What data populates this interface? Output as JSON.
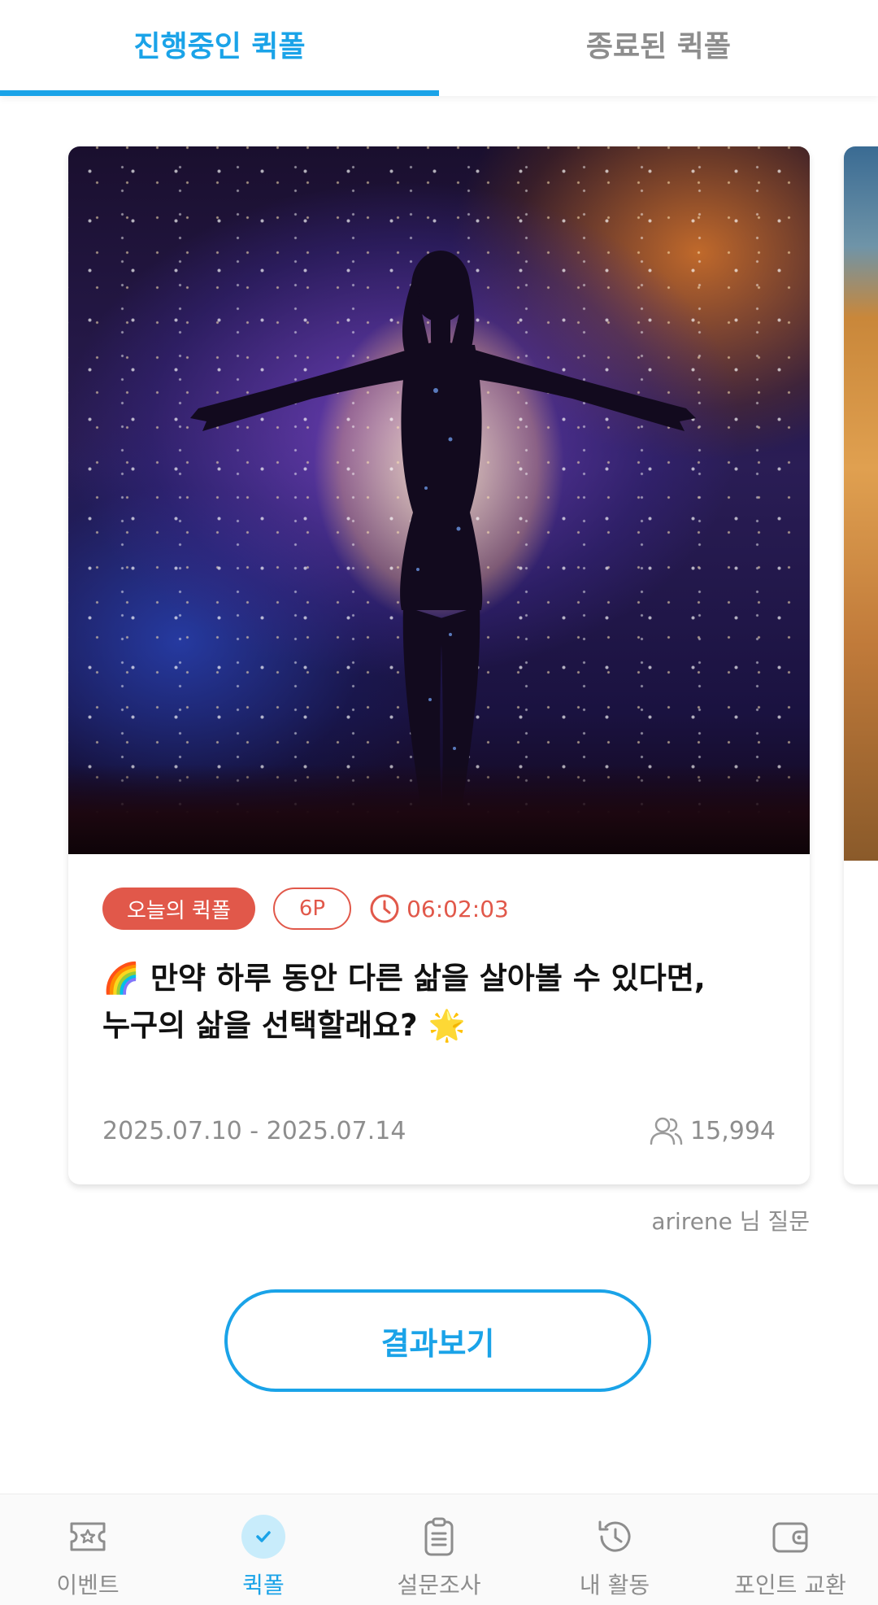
{
  "tabs": [
    {
      "label": "진행중인 퀵폴",
      "active": true
    },
    {
      "label": "종료된 퀵폴",
      "active": false
    }
  ],
  "card": {
    "badge_today": "오늘의 퀵폴",
    "badge_point": "6P",
    "timer": "06:02:03",
    "title": "🌈 만약 하루 동안 다른 삶을 살아볼 수 있다면,\n누구의 삶을 선택할래요? 🌟",
    "date_range": "2025.07.10 - 2025.07.14",
    "participants": "15,994"
  },
  "author": "arirene 님 질문",
  "result_button": "결과보기",
  "bottom_nav": [
    {
      "label": "이벤트",
      "icon": "ticket-icon",
      "active": false
    },
    {
      "label": "퀵폴",
      "icon": "check-circle-icon",
      "active": true
    },
    {
      "label": "설문조사",
      "icon": "clipboard-icon",
      "active": false
    },
    {
      "label": "내 활동",
      "icon": "history-icon",
      "active": false
    },
    {
      "label": "포인트 교환",
      "icon": "wallet-icon",
      "active": false
    }
  ],
  "colors": {
    "accent": "#1aa3e8",
    "badge_red": "#e1584a",
    "muted": "#8d8d8d"
  }
}
